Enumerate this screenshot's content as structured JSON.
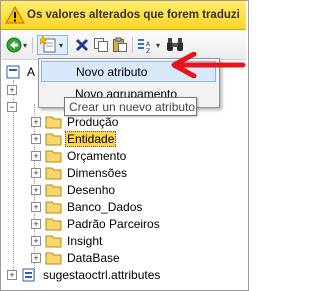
{
  "warning": {
    "text": "Os valores alterados que forem traduzi",
    "icon": "warning-triangle-icon",
    "color": "#ffd52a"
  },
  "toolbar": {
    "buttons": [
      {
        "name": "back",
        "icon": "green-circle-arrow-icon"
      },
      {
        "name": "new",
        "icon": "new-item-icon",
        "has_dropdown": true
      },
      {
        "name": "delete",
        "icon": "delete-x-icon"
      },
      {
        "name": "copy",
        "icon": "copy-icon"
      },
      {
        "name": "paste",
        "icon": "paste-icon"
      },
      {
        "name": "sort",
        "icon": "sort-az-icon",
        "has_dropdown": true
      },
      {
        "name": "find",
        "icon": "binoculars-icon"
      }
    ]
  },
  "menu": {
    "items": [
      {
        "label": "Novo atributo"
      },
      {
        "label": "Novo agrupamento"
      }
    ]
  },
  "tooltip": {
    "text": "Crear un nuevo atributo"
  },
  "tree": {
    "root_partial": "A",
    "items": [
      {
        "label": "Produção"
      },
      {
        "label": "Entidade",
        "selected": true
      },
      {
        "label": "Orçamento"
      },
      {
        "label": "Dimensões"
      },
      {
        "label": "Desenho"
      },
      {
        "label": "Banco_Dados"
      },
      {
        "label": "Padrão Parceiros"
      },
      {
        "label": "Insight"
      },
      {
        "label": "DataBase"
      }
    ],
    "bottom": {
      "label": "sugestaoctrl.attributes"
    }
  },
  "annotation": {
    "color": "#e8141c"
  }
}
